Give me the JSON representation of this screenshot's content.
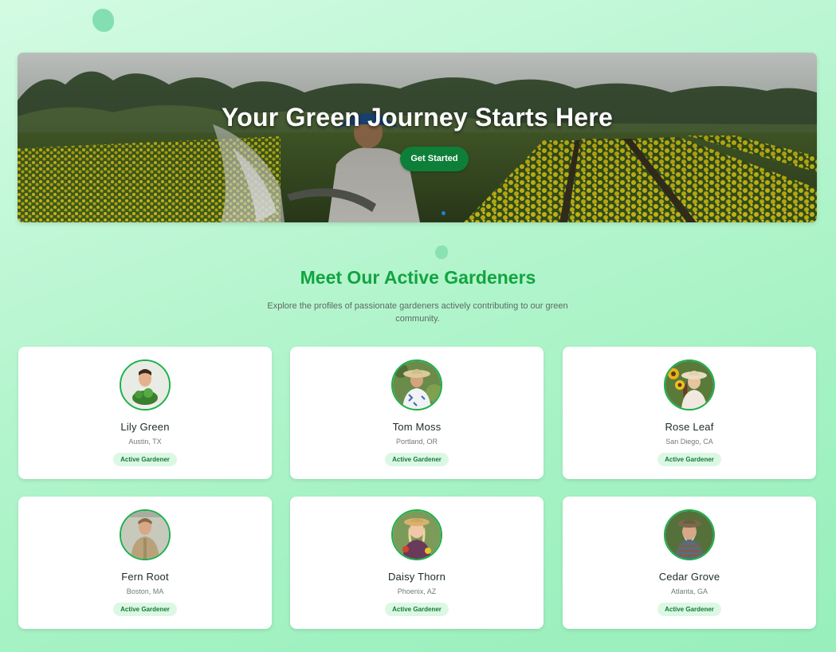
{
  "hero": {
    "title": "Your Green Journey Starts Here",
    "button_label": "Get Started",
    "slides_count": 2,
    "active_slide": 1
  },
  "section": {
    "title": "Meet Our Active Gardeners",
    "subtitle": "Explore the profiles of passionate gardeners actively contributing to our green community."
  },
  "gardeners": [
    {
      "name": "Lily Green",
      "location": "Austin, TX",
      "badge": "Active Gardener",
      "avatar_icon": "gardener-portrait-icon"
    },
    {
      "name": "Tom Moss",
      "location": "Portland, OR",
      "badge": "Active Gardener",
      "avatar_icon": "gardener-portrait-icon"
    },
    {
      "name": "Rose Leaf",
      "location": "San Diego, CA",
      "badge": "Active Gardener",
      "avatar_icon": "gardener-portrait-icon"
    },
    {
      "name": "Fern Root",
      "location": "Boston, MA",
      "badge": "Active Gardener",
      "avatar_icon": "gardener-portrait-icon"
    },
    {
      "name": "Daisy Thorn",
      "location": "Phoenix, AZ",
      "badge": "Active Gardener",
      "avatar_icon": "gardener-portrait-icon"
    },
    {
      "name": "Cedar Grove",
      "location": "Atlanta, GA",
      "badge": "Active Gardener",
      "avatar_icon": "gardener-portrait-icon"
    }
  ],
  "colors": {
    "accent_green": "#12a43f",
    "button_green": "#0e7f39",
    "badge_bg": "#dcf8e5",
    "badge_text": "#137a36",
    "avatar_ring": "#1bb04c"
  }
}
